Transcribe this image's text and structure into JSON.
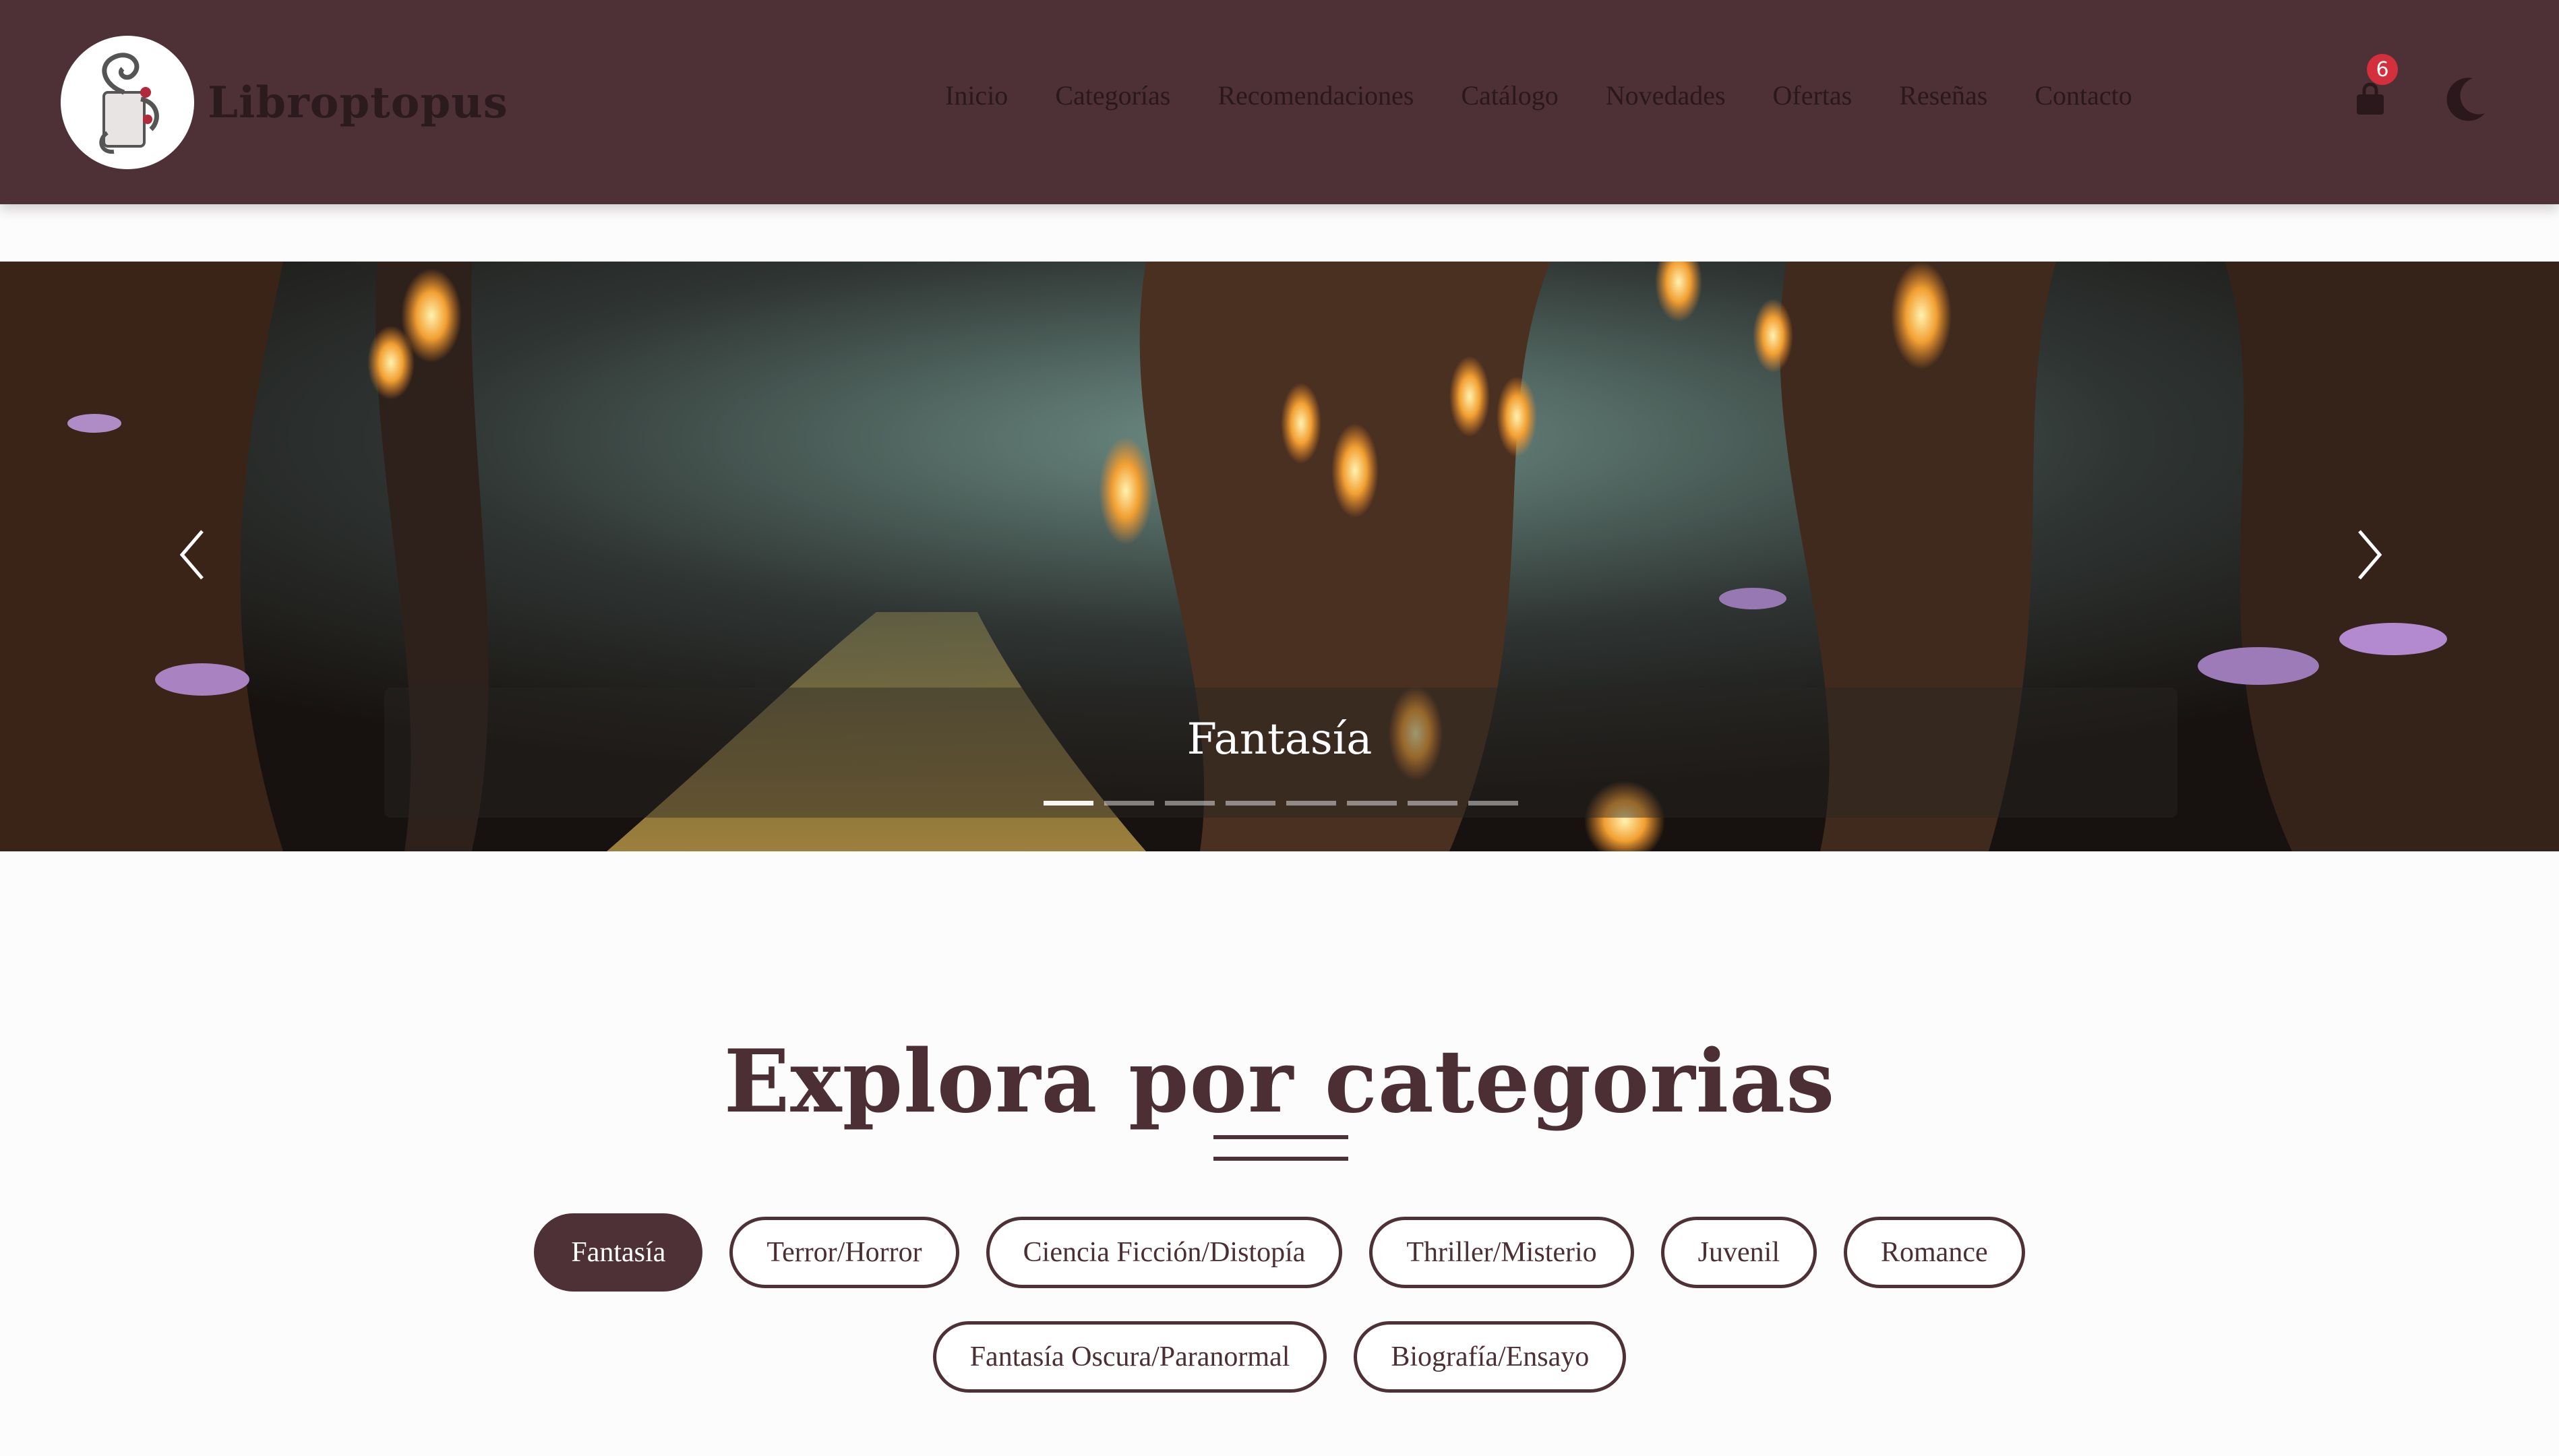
{
  "brand": {
    "name": "Libroptopus",
    "logo_icon": "octopus-book-logo"
  },
  "nav": {
    "links": [
      "Inicio",
      "Categorías",
      "Recomendaciones",
      "Catálogo",
      "Novedades",
      "Ofertas",
      "Reseñas",
      "Contacto"
    ],
    "cart_count": "6",
    "cart_icon": "shopping-bag-icon",
    "theme_icon": "moon-icon"
  },
  "carousel": {
    "caption": "Fantasía",
    "slide_count": 8,
    "active_index": 0,
    "prev_icon": "chevron-left-icon",
    "next_icon": "chevron-right-icon"
  },
  "section": {
    "title": "Explora por categorias",
    "categories_row1": [
      "Fantasía",
      "Terror/Horror",
      "Ciencia Ficción/Distopía",
      "Thriller/Misterio",
      "Juvenil",
      "Romance"
    ],
    "categories_row2": [
      "Fantasía Oscura/Paranormal",
      "Biografía/Ensayo"
    ],
    "active_category": "Fantasía"
  },
  "colors": {
    "primary": "#4e3137",
    "badge": "#d32f3c",
    "background": "#fdfcfc"
  }
}
